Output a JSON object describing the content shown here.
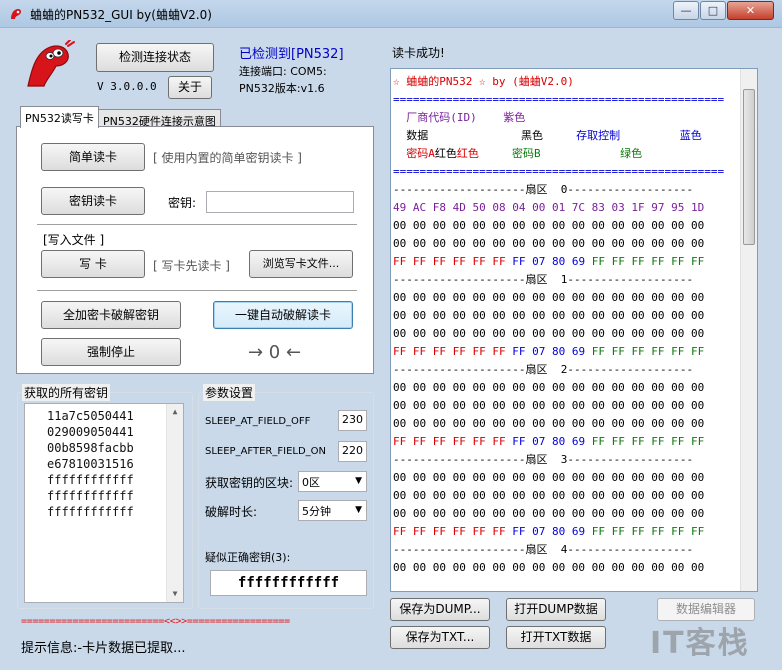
{
  "window": {
    "title": "蛐蛐的PN532_GUI by(蛐蛐V2.0)",
    "min_label": "—",
    "max_label": "□",
    "close_label": "✕"
  },
  "header": {
    "check_button": "检测连接状态",
    "version": "V 3.0.0.0",
    "about_button": "关于",
    "status_detected": "已检测到[PN532]",
    "port_line": "连接端口: COM5:",
    "fw_line": "PN532版本:v1.6"
  },
  "tabs": [
    {
      "label": "PN532读写卡"
    },
    {
      "label": "PN532硬件连接示意图"
    }
  ],
  "rw_panel": {
    "simple_read_button": "简单读卡",
    "simple_read_hint": "[ 使用内置的简单密钥读卡 ]",
    "key_read_button": "密钥读卡",
    "key_label": "密钥:",
    "key_value": "",
    "write_file_label": "[写入文件 ]",
    "write_button": "写 卡",
    "write_hint": "[ 写卡先读卡 ]",
    "browse_button": "浏览写卡文件...",
    "crack_full_button": "全加密卡破解密钥",
    "auto_crack_button": "一键自动破解读卡",
    "force_stop_button": "强制停止",
    "arrow_indicator": "→ 0 ←"
  },
  "keys_group": {
    "title": "获取的所有密钥",
    "keys": [
      "11a7c5050441",
      "029009050441",
      "00b8598facbb",
      "e67810031516",
      "ffffffffffff",
      "ffffffffffff",
      "ffffffffffff"
    ]
  },
  "params": {
    "title": "参数设置",
    "sleep_field_off_label": "SLEEP_AT_FIELD_OFF",
    "sleep_field_off_value": "230",
    "sleep_after_on_label": "SLEEP_AFTER_FIELD_ON",
    "sleep_after_on_value": "220",
    "key_block_label": "获取密钥的区块:",
    "key_block_value": "0区",
    "crack_time_label": "破解时长:",
    "crack_time_value": "5分钟",
    "suspected_label": "疑似正确密钥(3):",
    "suspected_value": "ffffffffffff"
  },
  "footer": {
    "divider": "=========================<<>>==================",
    "hint": "提示信息:-卡片数据已提取..."
  },
  "dump": {
    "title": "读卡成功!",
    "header_line": "☆ 蛐蛐的PN532 ☆ by (蛐蛐V2.0)",
    "eq_line": "==================================================",
    "legend": [
      {
        "label": "厂商代码(ID)",
        "color_name": "紫色"
      },
      {
        "label": "数据",
        "color_name": "黑色"
      },
      {
        "label": "存取控制",
        "color_name": "蓝色"
      },
      {
        "label": "密码A",
        "color_name": "红色"
      },
      {
        "label": "密码B",
        "color_name": "绿色"
      }
    ],
    "sectors": [
      {
        "label": "扇区  0",
        "rows": [
          "49 AC F8 4D 50 08 04 00 01 7C 83 03 1F 97 95 1D",
          "00 00 00 00 00 00 00 00 00 00 00 00 00 00 00 00",
          "00 00 00 00 00 00 00 00 00 00 00 00 00 00 00 00"
        ]
      },
      {
        "label": "扇区  1",
        "rows": [
          "00 00 00 00 00 00 00 00 00 00 00 00 00 00 00 00",
          "00 00 00 00 00 00 00 00 00 00 00 00 00 00 00 00",
          "00 00 00 00 00 00 00 00 00 00 00 00 00 00 00 00"
        ]
      },
      {
        "label": "扇区  2",
        "rows": [
          "00 00 00 00 00 00 00 00 00 00 00 00 00 00 00 00",
          "00 00 00 00 00 00 00 00 00 00 00 00 00 00 00 00",
          "00 00 00 00 00 00 00 00 00 00 00 00 00 00 00 00"
        ]
      },
      {
        "label": "扇区  3",
        "rows": [
          "00 00 00 00 00 00 00 00 00 00 00 00 00 00 00 00",
          "00 00 00 00 00 00 00 00 00 00 00 00 00 00 00 00",
          "00 00 00 00 00 00 00 00 00 00 00 00 00 00 00 00"
        ]
      },
      {
        "label": "扇区  4",
        "rows": [
          "00 00 00 00 00 00 00 00 00 00 00 00 00 00 00 00"
        ]
      }
    ],
    "trailer": {
      "keyA": "FF FF FF FF FF FF",
      "access": "FF 07 80 69",
      "keyB": "FF FF FF FF FF FF"
    },
    "buttons": {
      "save_dump": "保存为DUMP...",
      "open_dump": "打开DUMP数据",
      "data_editor": "数据编辑器",
      "save_txt": "保存为TXT...",
      "open_txt": "打开TXT数据"
    }
  },
  "watermark": "IT客栈",
  "colors": {
    "purple": "#7a1f9a",
    "black": "#000000",
    "blue": "#0000d8",
    "red": "#d80000",
    "green": "#0a7a0a",
    "status_blue": "#0000c8"
  }
}
